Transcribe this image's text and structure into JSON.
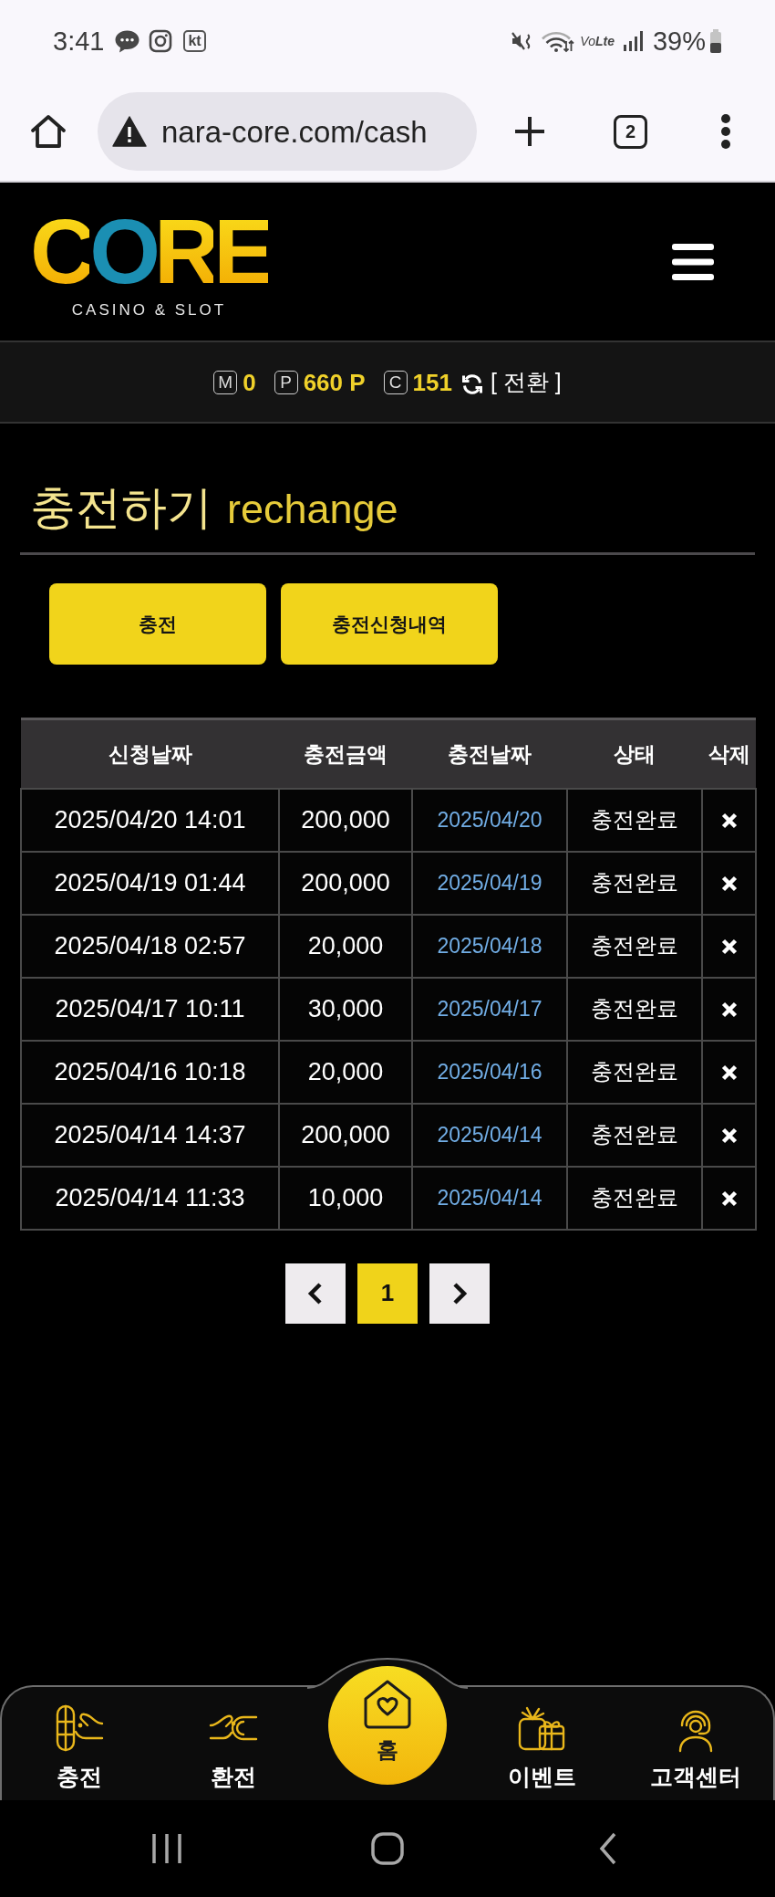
{
  "status_bar": {
    "time": "3:41",
    "carrier": "kt",
    "network": "Vo**Lte**",
    "battery": "39%"
  },
  "browser": {
    "url": "nara-core.com/cash",
    "tab_count": "2"
  },
  "header": {
    "logo": {
      "title": "CORE",
      "subtitle": "CASINO & SLOT"
    }
  },
  "balance_bar": {
    "items": [
      {
        "badge": "M",
        "value": "0"
      },
      {
        "badge": "P",
        "value": "660 P"
      },
      {
        "badge": "C",
        "value": "151"
      }
    ],
    "convert_link": "[ 전환 ]"
  },
  "page_title": {
    "korean": "충전하기",
    "english": "rechange"
  },
  "buttons": [
    "충전",
    "충전신청내역"
  ],
  "table": {
    "columns": [
      "신청날짜",
      "충전금액",
      "충전날짜",
      "상태",
      "삭제"
    ],
    "rows": [
      {
        "request_date": "2025/04/20 14:01",
        "amount": "200,000",
        "charge_date": "2025/04/20",
        "status": "충전완료"
      },
      {
        "request_date": "2025/04/19 01:44",
        "amount": "200,000",
        "charge_date": "2025/04/19",
        "status": "충전완료"
      },
      {
        "request_date": "2025/04/18 02:57",
        "amount": "20,000",
        "charge_date": "2025/04/18",
        "status": "충전완료"
      },
      {
        "request_date": "2025/04/17 10:11",
        "amount": "30,000",
        "charge_date": "2025/04/17",
        "status": "충전완료"
      },
      {
        "request_date": "2025/04/16 10:18",
        "amount": "20,000",
        "charge_date": "2025/04/16",
        "status": "충전완료"
      },
      {
        "request_date": "2025/04/14 14:37",
        "amount": "200,000",
        "charge_date": "2025/04/14",
        "status": "충전완료"
      },
      {
        "request_date": "2025/04/14 11:33",
        "amount": "10,000",
        "charge_date": "2025/04/14",
        "status": "충전완료"
      }
    ]
  },
  "pagination": {
    "pages": [
      {
        "label": "1",
        "selected": true
      }
    ]
  },
  "bottom_nav": [
    {
      "label": "충전",
      "kind": "tab"
    },
    {
      "label": "환전",
      "kind": "tab"
    },
    {
      "label": "홈",
      "kind": "home"
    },
    {
      "label": "이벤트",
      "kind": "tab"
    },
    {
      "label": "고객센터",
      "kind": "tab"
    }
  ]
}
